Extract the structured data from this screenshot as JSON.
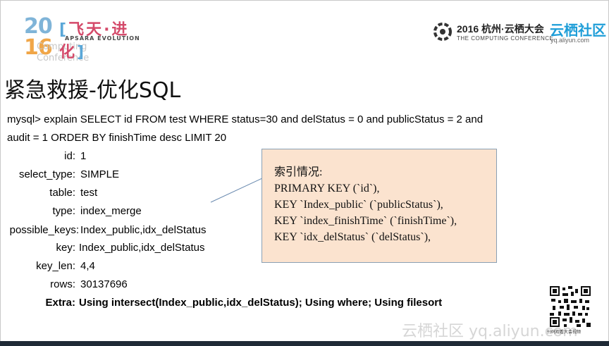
{
  "header": {
    "logo_year_top": "20",
    "logo_year_bottom": "16",
    "logo_sub": "Computing Conference",
    "logo_cn": "飞天·进化",
    "logo_en": "APSARA EVOLUTION",
    "conference_title": "2016 杭州·云栖大会",
    "conference_subtitle": "THE COMPUTING CONFERENCE",
    "brand_cn": "云栖社区",
    "brand_url": "yq.aliyun.com"
  },
  "slide": {
    "title": "紧急救援-优化SQL",
    "query_line1": "mysql> explain  SELECT id FROM test WHERE status=30 and delStatus = 0 and publicStatus = 2 and",
    "query_line2": "audit = 1  ORDER BY finishTime desc LIMIT 20",
    "explain_rows": [
      {
        "label": "id:",
        "value": "1"
      },
      {
        "label": "select_type:",
        "value": "SIMPLE"
      },
      {
        "label": "table:",
        "value": "test"
      },
      {
        "label": "type:",
        "value": "index_merge"
      },
      {
        "label": "possible_keys:",
        "value": "Index_public,idx_delStatus"
      },
      {
        "label": "key:",
        "value": "Index_public,idx_delStatus"
      },
      {
        "label": "key_len:",
        "value": "4,4"
      },
      {
        "label": "rows:",
        "value": "30137696"
      },
      {
        "label": "Extra:",
        "value": "Using intersect(Index_public,idx_delStatus); Using where; Using filesort"
      }
    ]
  },
  "callout": {
    "lines": [
      "索引情况:",
      "PRIMARY KEY (`id`),",
      "KEY `Index_public` (`publicStatus`),",
      "KEY `index_finishTime` (`finishTime`),",
      "KEY `idx_delStatus` (`delStatus`),"
    ]
  },
  "footer": {
    "qr_caption": "扫码观看大会视频",
    "watermark": "云栖社区 yq.aliyun.com"
  },
  "colors": {
    "callout_bg": "#fbe3cf",
    "brand_blue": "#1f9ed8",
    "bottom_bar": "#1f2a36"
  }
}
